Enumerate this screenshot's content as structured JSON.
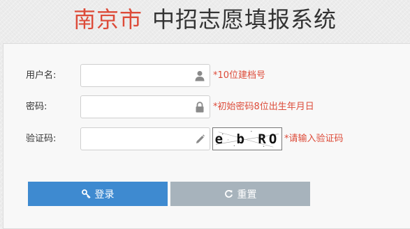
{
  "header": {
    "city": "南京市",
    "system_name": "中招志愿填报系统"
  },
  "form": {
    "username": {
      "label": "用户名:",
      "value": "",
      "hint": "*10位建档号",
      "icon": "user-icon"
    },
    "password": {
      "label": "密码:",
      "value": "",
      "hint": "*初始密码8位出生年月日",
      "icon": "lock-icon"
    },
    "captcha": {
      "label": "验证码:",
      "value": "",
      "hint": "*请输入验证码",
      "icon": "pencil-icon",
      "image_text": "e b RO"
    }
  },
  "buttons": {
    "login_label": "登录",
    "login_icon": "key-icon",
    "reset_label": "重置",
    "reset_icon": "refresh-icon"
  },
  "colors": {
    "accent_red": "#dd4b39",
    "login_blue": "#3e8ad0",
    "reset_gray": "#a7b3bc",
    "title_dark": "#333333"
  }
}
